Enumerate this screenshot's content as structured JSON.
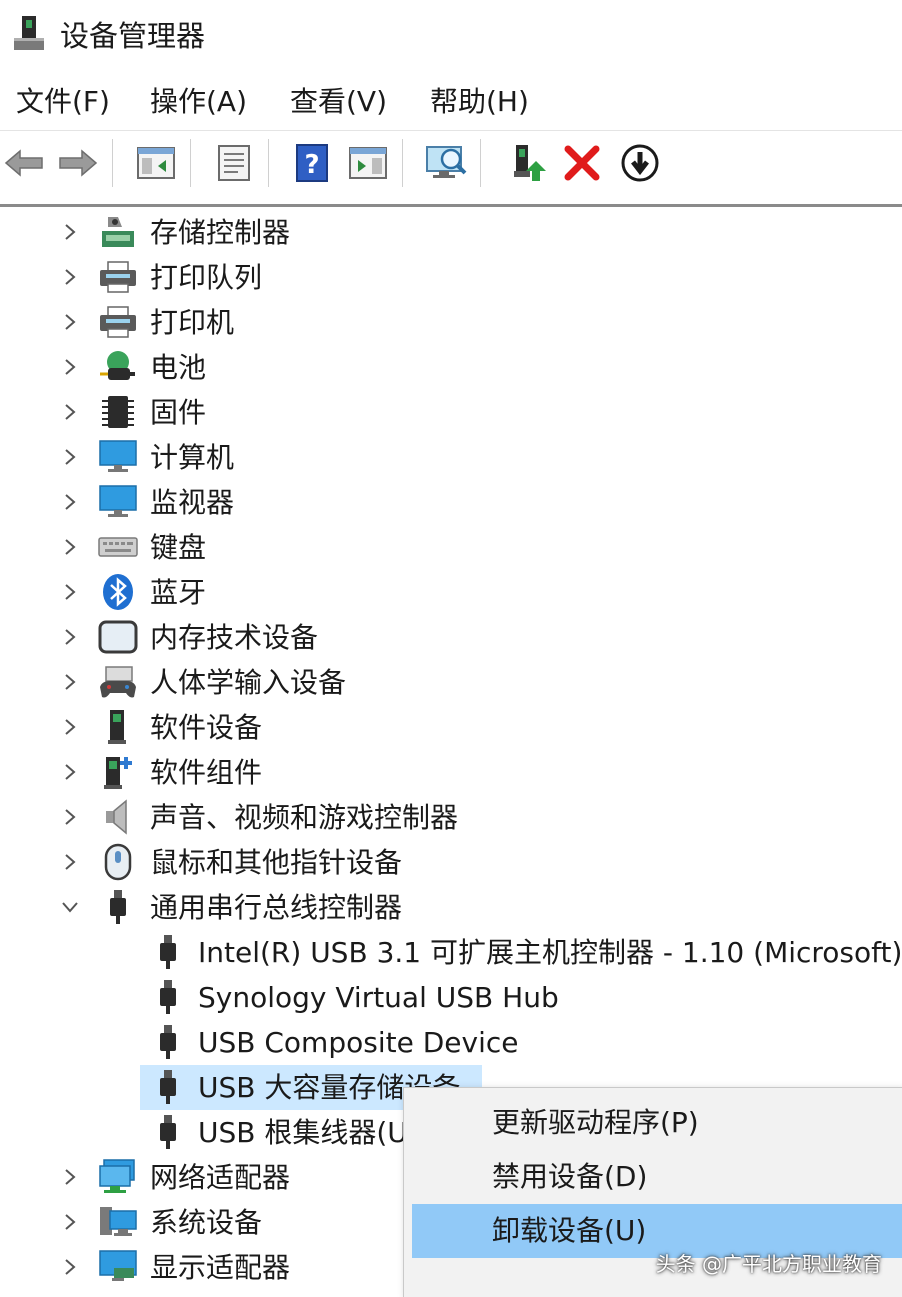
{
  "window": {
    "title": "设备管理器"
  },
  "menu": [
    "文件(F)",
    "操作(A)",
    "查看(V)",
    "帮助(H)"
  ],
  "toolbar": {
    "buttons": [
      "back-arrow-icon",
      "forward-arrow-icon",
      "show-hide-console-tree-icon",
      "properties-icon",
      "help-icon",
      "show-action-pane-icon",
      "scan-hardware-icon",
      "update-driver-icon",
      "uninstall-device-icon",
      "disable-device-icon"
    ]
  },
  "tree": {
    "categories": [
      {
        "label": "存储控制器",
        "icon": "storage-controller-icon"
      },
      {
        "label": "打印队列",
        "icon": "printer-queue-icon"
      },
      {
        "label": "打印机",
        "icon": "printer-icon"
      },
      {
        "label": "电池",
        "icon": "battery-icon"
      },
      {
        "label": "固件",
        "icon": "firmware-chip-icon"
      },
      {
        "label": "计算机",
        "icon": "computer-icon"
      },
      {
        "label": "监视器",
        "icon": "monitor-icon"
      },
      {
        "label": "键盘",
        "icon": "keyboard-icon"
      },
      {
        "label": "蓝牙",
        "icon": "bluetooth-icon"
      },
      {
        "label": "内存技术设备",
        "icon": "memory-device-icon"
      },
      {
        "label": "人体学输入设备",
        "icon": "hid-gamepad-icon"
      },
      {
        "label": "软件设备",
        "icon": "software-device-icon"
      },
      {
        "label": "软件组件",
        "icon": "software-component-icon"
      },
      {
        "label": "声音、视频和游戏控制器",
        "icon": "speaker-icon"
      },
      {
        "label": "鼠标和其他指针设备",
        "icon": "mouse-icon"
      },
      {
        "label": "通用串行总线控制器",
        "icon": "usb-plug-icon",
        "expanded": true
      }
    ],
    "usb_children": [
      {
        "label": "Intel(R) USB 3.1 可扩展主机控制器 - 1.10 (Microsoft)"
      },
      {
        "label": "Synology Virtual USB Hub"
      },
      {
        "label": "USB Composite Device"
      },
      {
        "label": "USB 大容量存储设备",
        "selected": true
      },
      {
        "label": "USB 根集线器(U"
      }
    ],
    "after": [
      {
        "label": "网络适配器",
        "icon": "network-adapter-icon"
      },
      {
        "label": "系统设备",
        "icon": "system-device-icon"
      },
      {
        "label": "显示适配器",
        "icon": "display-adapter-icon"
      }
    ]
  },
  "context_menu": {
    "items": [
      "更新驱动程序(P)",
      "禁用设备(D)",
      "卸载设备(U)"
    ],
    "highlighted_index": 2
  },
  "watermark": "头条 @广平北方职业教育",
  "colors": {
    "selection": "#cce8ff",
    "menu_hover": "#91c9f7",
    "menu_bg": "#f2f2f2"
  }
}
